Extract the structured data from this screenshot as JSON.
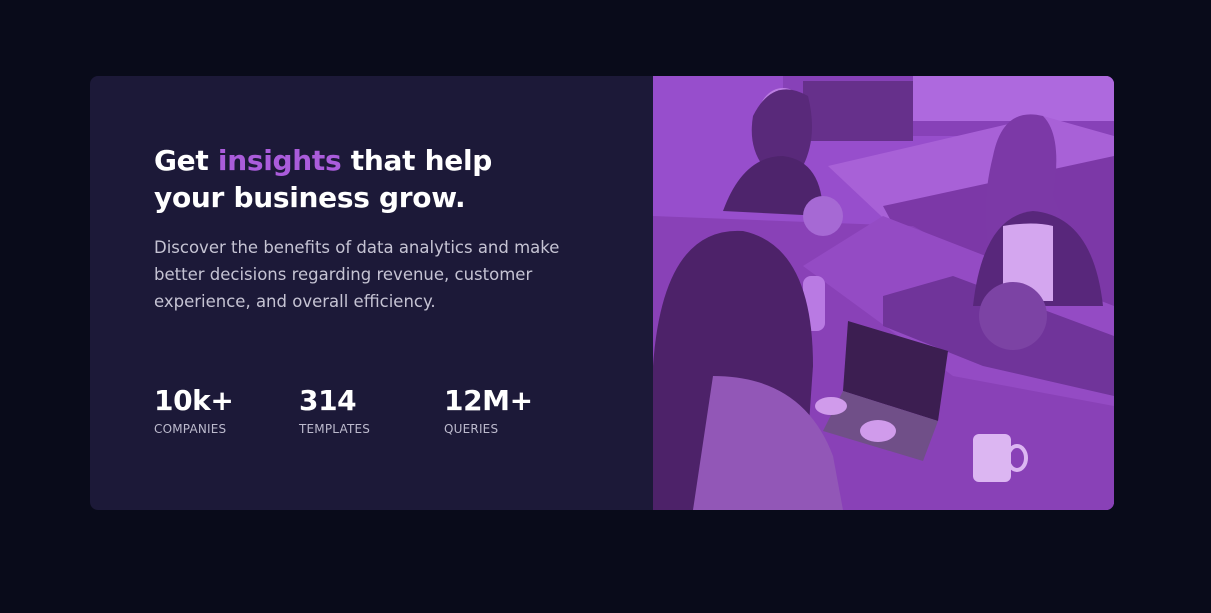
{
  "hero": {
    "title_before": "Get ",
    "title_accent": "insights",
    "title_after": " that help your business grow.",
    "description": "Discover the benefits of data analytics and make better decisions regarding revenue, customer experience, and overall efficiency."
  },
  "stats": [
    {
      "value": "10k+",
      "label": "COMPANIES"
    },
    {
      "value": "314",
      "label": "TEMPLATES"
    },
    {
      "value": "12M+",
      "label": "QUERIES"
    }
  ],
  "image": {
    "subject": "people working at a desk with laptop",
    "tint_color": "#aa5cdb"
  },
  "colors": {
    "background": "#090b1a",
    "card": "#1c1938",
    "accent": "#aa5cdb",
    "text": "#ffffff",
    "muted": "#c5c3d3"
  }
}
